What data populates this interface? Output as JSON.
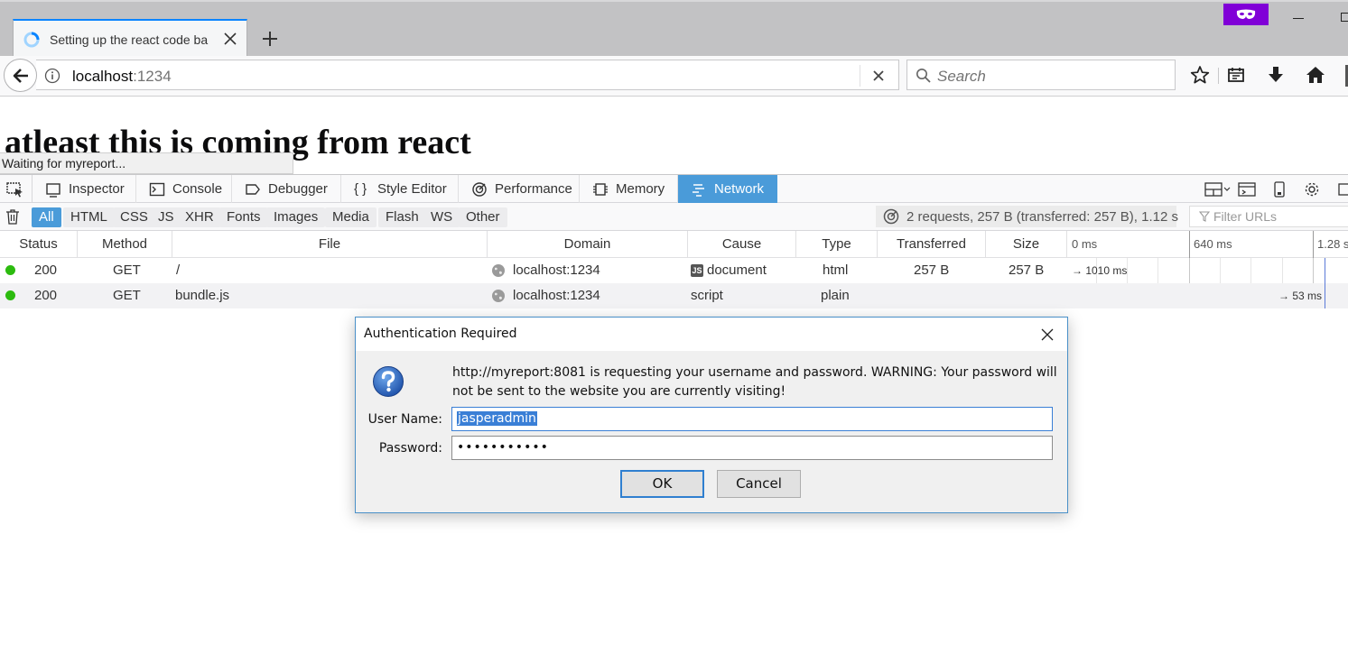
{
  "browser": {
    "tab": {
      "title": "Setting up the react code ba"
    },
    "urlbar": {
      "host": "localhost",
      "port": ":1234"
    },
    "search": {
      "placeholder": "Search"
    }
  },
  "page": {
    "heading": "atleast this is coming from react",
    "status_text": "Waiting for myreport..."
  },
  "devtools": {
    "tabs": [
      "Inspector",
      "Console",
      "Debugger",
      "Style Editor",
      "Performance",
      "Memory",
      "Network"
    ],
    "active_tab": "Network",
    "filters": [
      "All",
      "HTML",
      "CSS",
      "JS",
      "XHR",
      "Fonts",
      "Images",
      "Media",
      "Flash",
      "WS",
      "Other"
    ],
    "active_filter": "All",
    "summary": "2 requests, 257 B (transferred: 257 B), 1.12 s",
    "filter_placeholder": "Filter URLs",
    "columns": [
      "Status",
      "Method",
      "File",
      "Domain",
      "Cause",
      "Type",
      "Transferred",
      "Size"
    ],
    "waterfall_ticks": [
      "0 ms",
      "640 ms",
      "1.28 s"
    ],
    "requests": [
      {
        "status": "200",
        "method": "GET",
        "file": "/",
        "domain": "localhost:1234",
        "cause": "document",
        "cause_badge": "JS",
        "type": "html",
        "transferred": "257 B",
        "size": "257 B",
        "timing": "→ 1010 ms"
      },
      {
        "status": "200",
        "method": "GET",
        "file": "bundle.js",
        "domain": "localhost:1234",
        "cause": "script",
        "type": "plain",
        "transferred": "",
        "size": "",
        "timing": "→ 53 ms"
      }
    ]
  },
  "dialog": {
    "title": "Authentication Required",
    "message": "http://myreport:8081 is requesting your username and password. WARNING: Your password will not be sent to the website you are currently visiting!",
    "username_label": "User Name:",
    "username_value": "jasperadmin",
    "password_label": "Password:",
    "password_value": "•••••••••••",
    "ok_label": "OK",
    "cancel_label": "Cancel"
  }
}
